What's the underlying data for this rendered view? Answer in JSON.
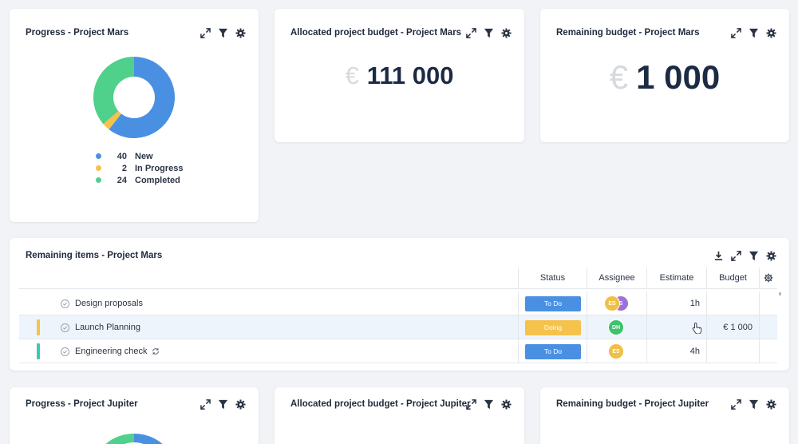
{
  "colors": {
    "new": "#4a90e2",
    "in_progress": "#f5c24c",
    "completed": "#4fd08b",
    "todo": "#4a90e2",
    "doing": "#f5c24c",
    "row_highlight": "#eef4fb"
  },
  "icons": [
    "expand-icon",
    "filter-icon",
    "gear-icon",
    "download-icon",
    "pointer-cursor-icon",
    "check-circle-icon",
    "repeat-icon"
  ],
  "progress_mars": {
    "title": "Progress - Project Mars",
    "chart_data": {
      "type": "pie",
      "categories": [
        "New",
        "In Progress",
        "Completed"
      ],
      "values": [
        40,
        2,
        24
      ],
      "colors": [
        "#4a90e2",
        "#f5c24c",
        "#4fd08b"
      ]
    },
    "legend": [
      {
        "value": "40",
        "label": "New"
      },
      {
        "value": "2",
        "label": "In Progress"
      },
      {
        "value": "24",
        "label": "Completed"
      }
    ]
  },
  "allocated_mars": {
    "title": "Allocated project budget - Project Mars",
    "currency": "€",
    "value": "111 000"
  },
  "remaining_mars": {
    "title": "Remaining budget - Project Mars",
    "currency": "€",
    "value": "1 000"
  },
  "remaining_items": {
    "title": "Remaining items - Project Mars",
    "columns": [
      "Status",
      "Assignee",
      "Estimate",
      "Budget"
    ],
    "rows": [
      {
        "name": "Design proposals",
        "status": "To Do",
        "assignees": [
          "ES",
          "S"
        ],
        "estimate": "1h",
        "budget": ""
      },
      {
        "name": "Launch Planning",
        "status": "Doing",
        "assignees": [
          "DH"
        ],
        "estimate": "",
        "budget": "€ 1 000"
      },
      {
        "name": "Engineering check",
        "status": "To Do",
        "assignees": [
          "ES"
        ],
        "estimate": "4h",
        "budget": ""
      }
    ]
  },
  "progress_jupiter": {
    "title": "Progress - Project Jupiter"
  },
  "allocated_jupiter": {
    "title": "Allocated project budget - Project Jupiter"
  },
  "remaining_jupiter": {
    "title": "Remaining budget - Project Jupiter"
  }
}
